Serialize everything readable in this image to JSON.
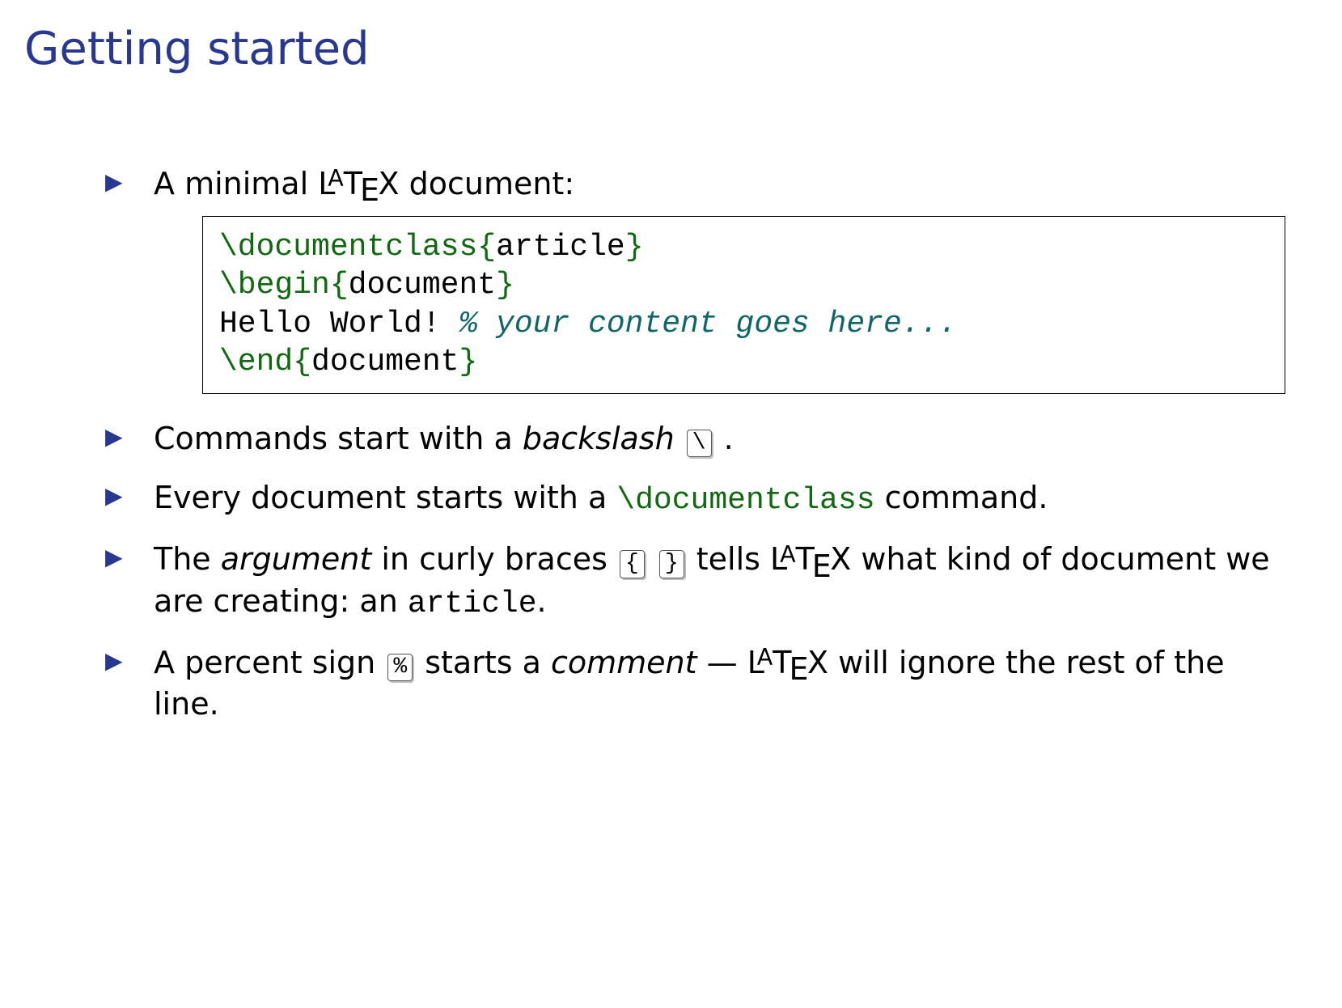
{
  "title": "Getting started",
  "bullet1_prefix": "A minimal ",
  "bullet1_suffix": " document:",
  "code": {
    "l1_cmd": "\\documentclass",
    "l1_open": "{",
    "l1_arg": "article",
    "l1_close": "}",
    "l2_cmd": "\\begin",
    "l2_open": "{",
    "l2_arg": "document",
    "l2_close": "}",
    "l3_text": "Hello World!  ",
    "l3_comment": "% your content goes here...",
    "l4_cmd": "\\end",
    "l4_open": "{",
    "l4_arg": "document",
    "l4_close": "}"
  },
  "bullet2_a": "Commands start with a ",
  "bullet2_term": "backslash",
  "bullet2_key": "\\",
  "bullet2_dot": " .",
  "bullet3_a": "Every document starts with a ",
  "bullet3_cmd": "\\documentclass",
  "bullet3_b": " command.",
  "bullet4_a": "The ",
  "bullet4_term": "argument",
  "bullet4_b": " in curly braces ",
  "bullet4_key1": "{",
  "bullet4_key2": "}",
  "bullet4_c": "  tells ",
  "bullet4_d": " what kind of document we are creating: an ",
  "bullet4_tt": "article",
  "bullet4_e": ".",
  "bullet5_a": "A percent sign ",
  "bullet5_key": "%",
  "bullet5_b": "  starts a ",
  "bullet5_term": "comment",
  "bullet5_c": " — ",
  "bullet5_d": " will ignore the rest of the line.",
  "latex": {
    "L": "L",
    "A": "A",
    "T": "T",
    "E": "E",
    "X": "X"
  }
}
